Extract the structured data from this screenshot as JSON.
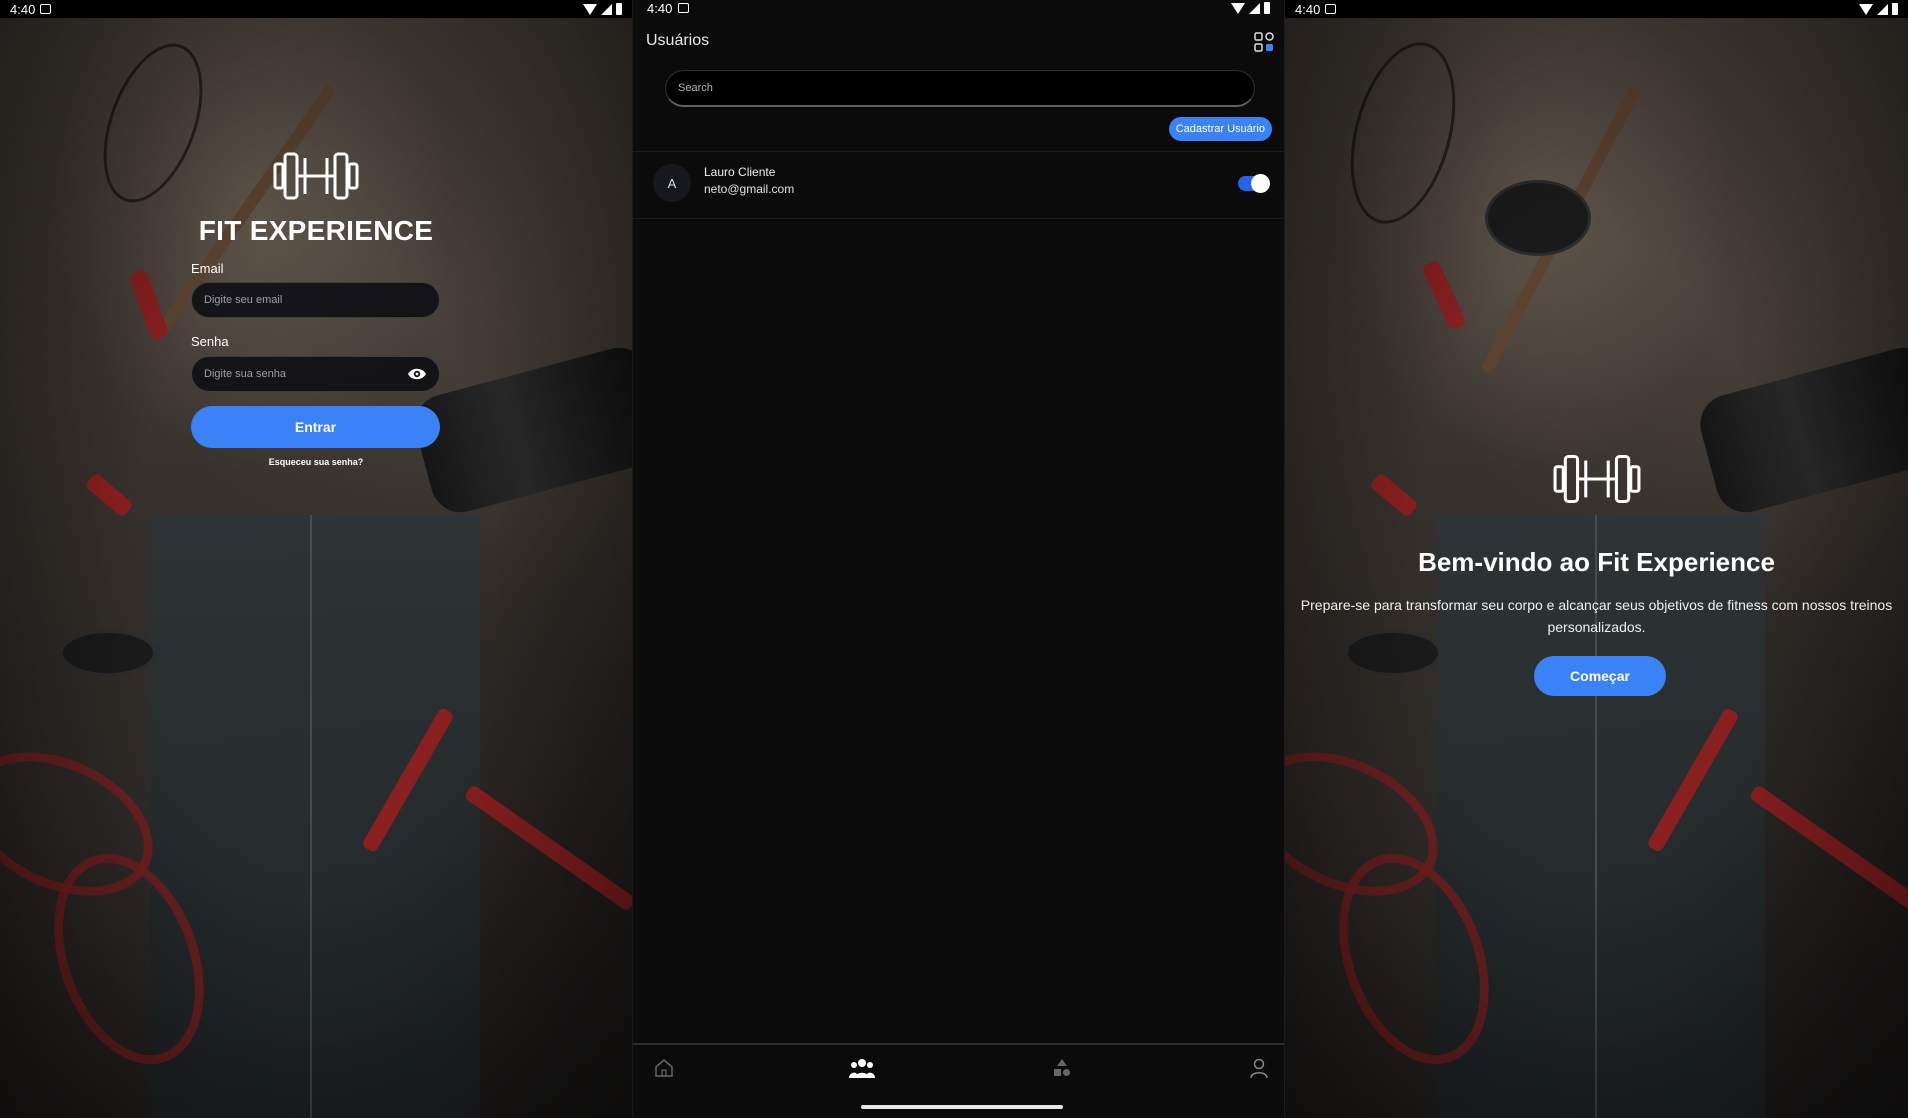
{
  "status_bar": {
    "time": "4:40"
  },
  "login": {
    "app_title": "FIT EXPERIENCE",
    "email_label": "Email",
    "email_placeholder": "Digite seu email",
    "password_label": "Senha",
    "password_placeholder": "Digite sua senha",
    "submit_label": "Entrar",
    "forgot_link": "Esqueceu sua senha?"
  },
  "users": {
    "title": "Usuários",
    "search_placeholder": "Search",
    "add_button": "Cadastrar Usuário",
    "list": [
      {
        "avatar_initial": "A",
        "name": "Lauro Cliente",
        "email": "neto@gmail.com",
        "active": true
      }
    ],
    "nav": [
      {
        "icon": "home-icon",
        "active": false
      },
      {
        "icon": "users-group-icon",
        "active": true
      },
      {
        "icon": "shapes-icon",
        "active": false
      },
      {
        "icon": "profile-icon",
        "active": false
      }
    ]
  },
  "welcome": {
    "title": "Bem-vindo ao Fit Experience",
    "text": "Prepare-se para transformar seu corpo e alcançar seus objetivos de fitness com nossos treinos personalizados.",
    "button": "Começar"
  },
  "colors": {
    "accent": "#3b82f6",
    "background": "#0b0b0c"
  }
}
